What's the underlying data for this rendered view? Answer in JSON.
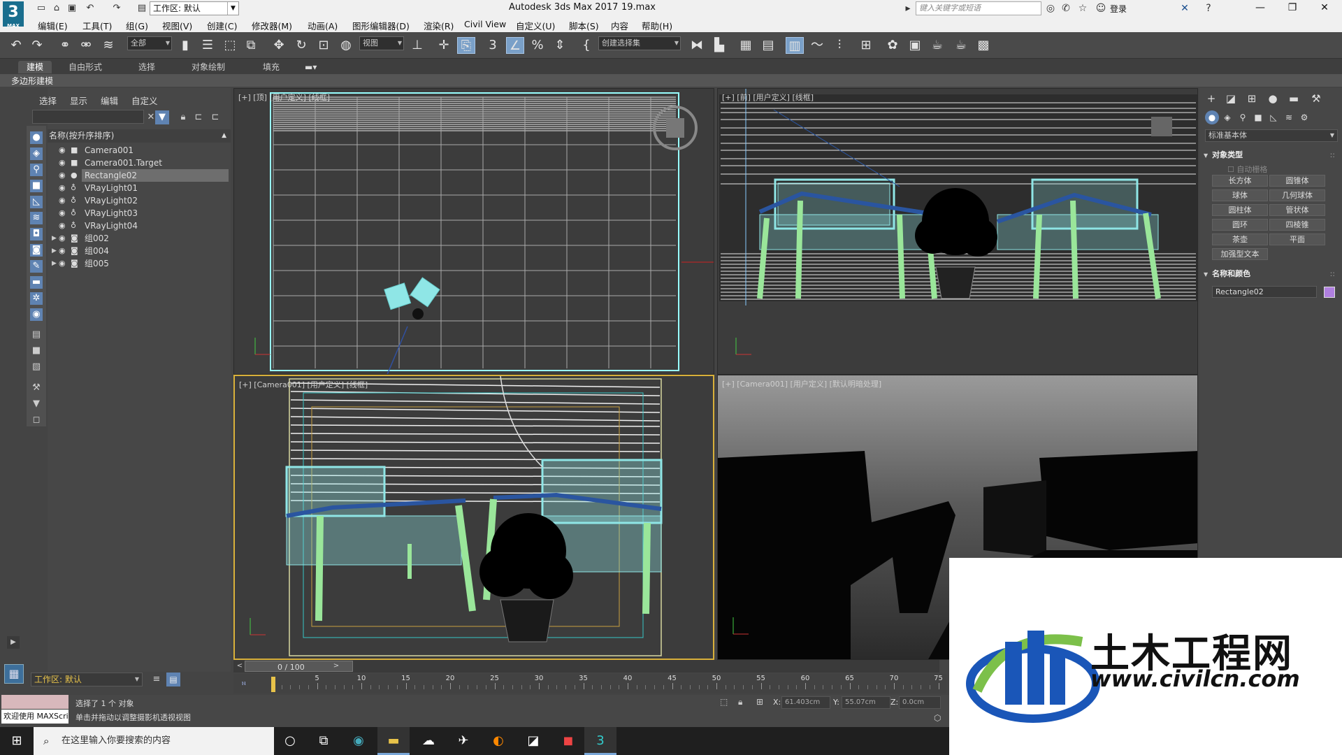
{
  "titlebar": {
    "logo_text": "3",
    "logo_sub": "MAX",
    "workspace_label": "工作区: 默认",
    "app_title": "Autodesk 3ds Max 2017",
    "file_name": "19.max",
    "search_placeholder": "键入关键字或短语",
    "login_label": "登录"
  },
  "menu": [
    "编辑(E)",
    "工具(T)",
    "组(G)",
    "视图(V)",
    "创建(C)",
    "修改器(M)",
    "动画(A)",
    "图形编辑器(D)",
    "渲染(R)",
    "Civil View",
    "自定义(U)",
    "脚本(S)",
    "内容",
    "帮助(H)"
  ],
  "toolbar": {
    "filter_combo": "全部",
    "refcoord_combo": "视图",
    "selection_set_combo": "创建选择集"
  },
  "ribbon": {
    "tabs": [
      "建模",
      "自由形式",
      "选择",
      "对象绘制",
      "填充"
    ],
    "active_tab": "建模",
    "sub_label": "多边形建模"
  },
  "explorer": {
    "tabs": [
      "选择",
      "显示",
      "编辑",
      "自定义"
    ],
    "header": "名称(按升序排序)",
    "rows": [
      {
        "name": "Camera001",
        "type": "camera",
        "expandable": false,
        "selected": false
      },
      {
        "name": "Camera001.Target",
        "type": "camera",
        "expandable": false,
        "selected": false
      },
      {
        "name": "Rectangle02",
        "type": "shape",
        "expandable": false,
        "selected": true
      },
      {
        "name": "VRayLight01",
        "type": "light",
        "expandable": false,
        "selected": false
      },
      {
        "name": "VRayLight02",
        "type": "light",
        "expandable": false,
        "selected": false
      },
      {
        "name": "VRayLight03",
        "type": "light",
        "expandable": false,
        "selected": false
      },
      {
        "name": "VRayLight04",
        "type": "light",
        "expandable": false,
        "selected": false
      },
      {
        "name": "组002",
        "type": "group",
        "expandable": true,
        "selected": false
      },
      {
        "name": "组004",
        "type": "group",
        "expandable": true,
        "selected": false
      },
      {
        "name": "组005",
        "type": "group",
        "expandable": true,
        "selected": false
      }
    ],
    "workspace": "工作区: 默认"
  },
  "viewports": {
    "top": "[+] [顶] [用户定义] [线框]",
    "front": "[+] [前] [用户定义] [线框]",
    "camera_wire": "[+] [Camera001] [用户定义] [线框]",
    "camera_shaded": "[+] [Camera001] [用户定义] [默认明暗处理]"
  },
  "command_panel": {
    "category_combo": "标准基本体",
    "object_type_title": "对象类型",
    "autogrid": "自动栅格",
    "buttons": [
      "长方体",
      "圆锥体",
      "球体",
      "几何球体",
      "圆柱体",
      "管状体",
      "圆环",
      "四棱锥",
      "茶壶",
      "平面",
      "加强型文本"
    ],
    "name_color_title": "名称和颜色",
    "object_name": "Rectangle02",
    "object_color": "#b080e0"
  },
  "timeline": {
    "frame_label": "0 / 100",
    "ticks": [
      5,
      10,
      15,
      20,
      25,
      30,
      35,
      40,
      45,
      50,
      55,
      60,
      65,
      70,
      75
    ],
    "current_frame": 0
  },
  "status": {
    "welcome": "欢迎使用 MAXScript",
    "line1": "选择了 1 个 对象",
    "line2": "单击并拖动以调整摄影机透视视图",
    "x_label": "X:",
    "x_value": "61.403cm",
    "y_label": "Y:",
    "y_value": "55.07cm",
    "z_label": "Z:",
    "z_value": "0.0cm"
  },
  "taskbar": {
    "search_placeholder": "在这里输入你要搜索的内容"
  },
  "watermark": {
    "title": "土木工程网",
    "url": "www.civilcn.com"
  },
  "colors": {
    "selected_viewport_border": "#d8b03a",
    "wire_cyan": "#8fe6e6",
    "wire_green": "#9ae69a",
    "accent_blue": "#5f83b2"
  }
}
